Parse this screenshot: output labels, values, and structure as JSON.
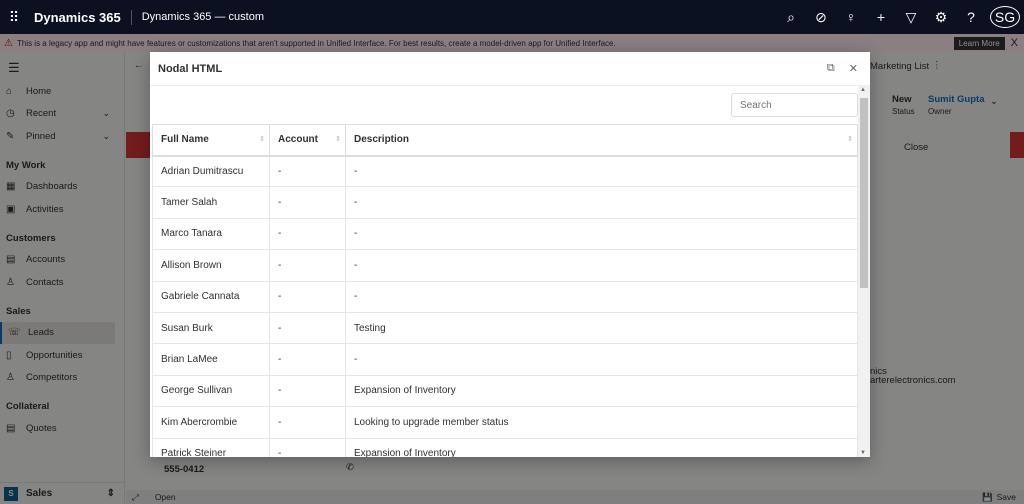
{
  "topbar": {
    "brand": "Dynamics 365",
    "app": "Dynamics 365 — custom",
    "avatar": "SG",
    "icons": [
      "search-icon",
      "task-icon",
      "lightbulb-icon",
      "plus-icon",
      "filter-icon",
      "gear-icon",
      "help-icon"
    ]
  },
  "banner": {
    "message": "This is a legacy app and might have features or customizations that aren't supported in Unified Interface. For best results, create a model-driven app for Unified Interface.",
    "learn_more": "Learn More",
    "close": "X"
  },
  "sidebar": {
    "top": [
      {
        "label": "Home",
        "icon": "⌂"
      },
      {
        "label": "Recent",
        "icon": "◷",
        "chev": true
      },
      {
        "label": "Pinned",
        "icon": "✎",
        "chev": true
      }
    ],
    "groups": [
      {
        "title": "My Work",
        "items": [
          {
            "label": "Dashboards",
            "icon": "▦"
          },
          {
            "label": "Activities",
            "icon": "▣"
          }
        ]
      },
      {
        "title": "Customers",
        "items": [
          {
            "label": "Accounts",
            "icon": "▤"
          },
          {
            "label": "Contacts",
            "icon": "♙"
          }
        ]
      },
      {
        "title": "Sales",
        "items": [
          {
            "label": "Leads",
            "icon": "☏",
            "selected": true
          },
          {
            "label": "Opportunities",
            "icon": "▯"
          },
          {
            "label": "Competitors",
            "icon": "♙"
          }
        ]
      },
      {
        "title": "Collateral",
        "items": [
          {
            "label": "Quotes",
            "icon": "▤"
          }
        ]
      }
    ],
    "area": {
      "badge": "S",
      "label": "Sales"
    }
  },
  "background": {
    "marketing_list": "Marketing List",
    "status_value": "New",
    "status_label": "Status",
    "owner_value": "Sumit Gupta",
    "owner_label": "Owner",
    "stage": "Close",
    "phone": "555-0412",
    "email_fragment": "arterelectronics.com",
    "company_fragment": "nics",
    "open": "Open",
    "save": "Save"
  },
  "modal": {
    "title": "Nodal HTML",
    "search_placeholder": "Search",
    "columns": [
      "Full Name",
      "Account",
      "Description"
    ],
    "rows": [
      [
        "Adrian Dumitrascu",
        "-",
        "-"
      ],
      [
        "Tamer Salah",
        "-",
        "-"
      ],
      [
        "Marco Tanara",
        "-",
        "-"
      ],
      [
        "Allison Brown",
        "-",
        "-"
      ],
      [
        "Gabriele Cannata",
        "-",
        "-"
      ],
      [
        "Susan Burk",
        "-",
        "Testing"
      ],
      [
        "Brian LaMee",
        "-",
        "-"
      ],
      [
        "George Sullivan",
        "-",
        "Expansion of Inventory"
      ],
      [
        "Kim Abercrombie",
        "-",
        "Looking to upgrade member status"
      ],
      [
        "Patrick Steiner",
        "-",
        "Expansion of Inventory"
      ]
    ]
  }
}
